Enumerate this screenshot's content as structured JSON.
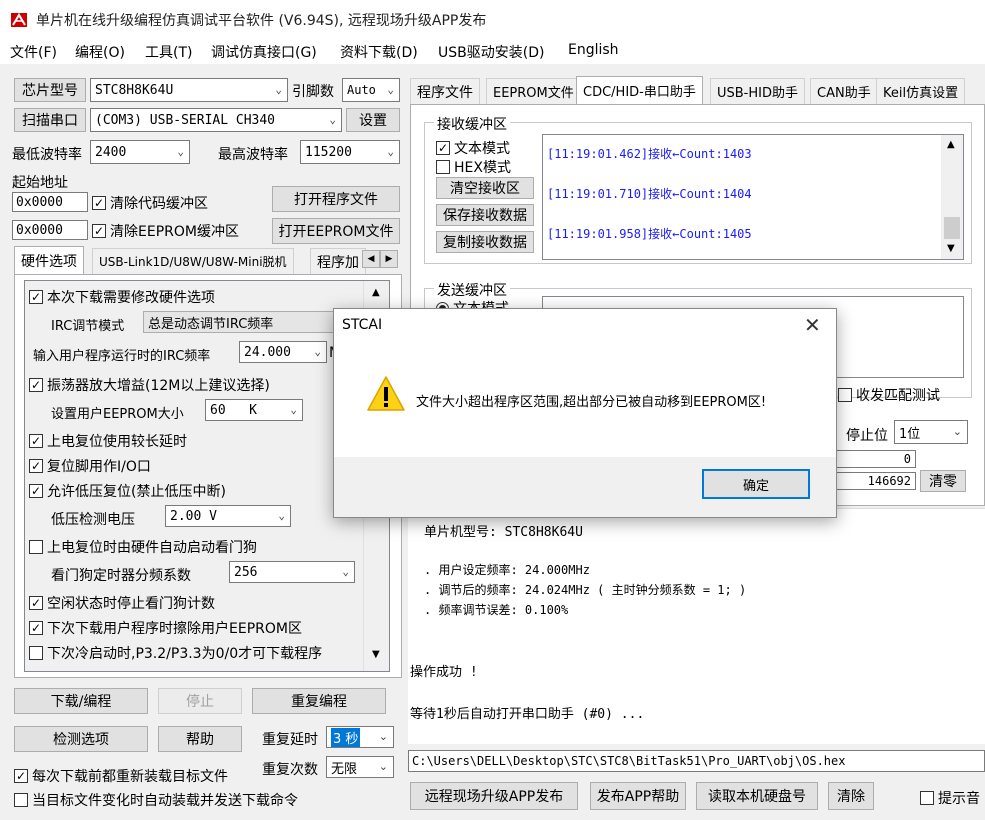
{
  "window": {
    "title": "单片机在线升级编程仿真调试平台软件 (V6.94S), 远程现场升级APP发布"
  },
  "menu": [
    "文件(F)",
    "编程(O)",
    "工具(T)",
    "调试仿真接口(G)",
    "资料下载(D)",
    "USB驱动安装(D)",
    "English"
  ],
  "left": {
    "chip_type_btn": "芯片型号",
    "chip_type_value": "STC8H8K64U",
    "pin_count_label": "引脚数",
    "pin_count_value": "Auto",
    "scan_port_btn": "扫描串口",
    "port_value": "(COM3) USB-SERIAL CH340",
    "settings_btn": "设置",
    "min_baud_label": "最低波特率",
    "min_baud_value": "2400",
    "max_baud_label": "最高波特率",
    "max_baud_value": "115200",
    "start_addr_label": "起始地址",
    "addr1": "0x0000",
    "addr2": "0x0000",
    "clear_code_buf": "清除代码缓冲区",
    "clear_eeprom_buf": "清除EEPROM缓冲区",
    "open_program_btn": "打开程序文件",
    "open_eeprom_btn": "打开EEPROM文件",
    "tabs": [
      "硬件选项",
      "USB-Link1D/U8W/U8W-Mini脱机",
      "程序加"
    ],
    "hw": {
      "opt_modify": "本次下载需要修改硬件选项",
      "irc_mode_label": "IRC调节模式",
      "irc_mode_value": "总是动态调节IRC频率",
      "irc_freq_label": "输入用户程序运行时的IRC频率",
      "irc_freq_value": "24.000",
      "irc_freq_unit": "M",
      "osc_gain": "振荡器放大增益(12M以上建议选择)",
      "eeprom_size_label": "设置用户EEPROM大小",
      "eeprom_size_value": "60   K",
      "power_delay": "上电复位使用较长延时",
      "reset_io": "复位脚用作I/O口",
      "low_volt_reset": "允许低压复位(禁止低压中断)",
      "low_volt_label": "低压检测电压",
      "low_volt_value": "2.00 V",
      "wdt_auto": "上电复位时由硬件自动启动看门狗",
      "wdt_div_label": "看门狗定时器分频系数",
      "wdt_div_value": "256",
      "idle_stop_wdt": "空闲状态时停止看门狗计数",
      "erase_eeprom": "下次下载用户程序时擦除用户EEPROM区",
      "p32_p33": "下次冷启动时,P3.2/P3.3为0/0才可下载程序"
    },
    "download_btn": "下载/编程",
    "stop_btn": "停止",
    "repeat_prog_btn": "重复编程",
    "detect_btn": "检测选项",
    "help_btn": "帮助",
    "repeat_delay_label": "重复延时",
    "repeat_delay_value": "3 秒",
    "repeat_count_label": "重复次数",
    "repeat_count_value": "无限",
    "reload_each": "每次下载前都重新装载目标文件",
    "auto_reload": "当目标文件变化时自动装载并发送下载命令"
  },
  "right": {
    "tabs": [
      "程序文件",
      "EEPROM文件",
      "CDC/HID-串口助手",
      "USB-HID助手",
      "CAN助手",
      "Keil仿真设置"
    ],
    "recv_group": "接收缓冲区",
    "text_mode": "文本模式",
    "hex_mode": "HEX模式",
    "clear_recv_btn": "清空接收区",
    "save_recv_btn": "保存接收数据",
    "copy_recv_btn": "复制接收数据",
    "recv_lines": [
      "[11:19:01.462]接收←Count:1403",
      "[11:19:01.710]接收←Count:1404",
      "[11:19:01.958]接收←Count:1405"
    ],
    "send_group": "发送缓冲区",
    "send_text_mode": "文本模式",
    "match_test": "收发匹配测试",
    "stop_bit_label": "停止位",
    "stop_bit_value": "1位",
    "counter1": "0",
    "counter2": "146692",
    "clear_count_btn": "清零",
    "log": {
      "mcu_model": "单片机型号: STC8H8K64U",
      "user_freq": ". 用户设定频率: 24.000MHz",
      "adj_freq": ". 调节后的频率: 24.024MHz ( 主时钟分频系数 = 1; )",
      "freq_err": ". 频率调节误差: 0.100%",
      "success": "操作成功 !",
      "wait": "等待1秒后自动打开串口助手 (#0) ..."
    },
    "file_path": "C:\\Users\\DELL\\Desktop\\STC\\STC8\\BitTask51\\Pro_UART\\obj\\OS.hex",
    "remote_btn": "远程现场升级APP发布",
    "app_help_btn": "发布APP帮助",
    "read_disk_btn": "读取本机硬盘号",
    "clear_btn": "清除",
    "beep": "提示音"
  },
  "dialog": {
    "title": "STCAI",
    "message": "文件大小超出程序区范围,超出部分已被自动移到EEPROM区!",
    "ok_btn": "确定"
  },
  "colors": {
    "accent": "#0078d7",
    "recv_text": "#1a1aff"
  }
}
